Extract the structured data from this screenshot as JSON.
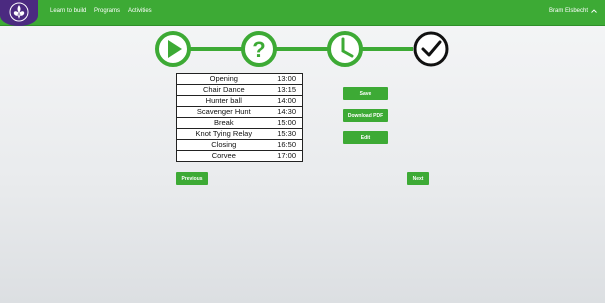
{
  "navbar": {
    "links": [
      "Learn to build",
      "Programs",
      "Activities"
    ],
    "user_name": "Bram Elsbecht"
  },
  "stepper": {
    "steps": [
      "play-step-icon",
      "question-step-icon",
      "clock-step-icon",
      "check-step-icon"
    ],
    "active_color": "#3daa35",
    "current_step_color": "#111111"
  },
  "schedule": [
    {
      "activity": "Opening",
      "time": "13:00"
    },
    {
      "activity": "Chair Dance",
      "time": "13:15"
    },
    {
      "activity": "Hunter ball",
      "time": "14:00"
    },
    {
      "activity": "Scavenger Hunt",
      "time": "14:30"
    },
    {
      "activity": "Break",
      "time": "15:00"
    },
    {
      "activity": "Knot Tying Relay",
      "time": "15:30"
    },
    {
      "activity": "Closing",
      "time": "16:50"
    },
    {
      "activity": "Corvee",
      "time": "17:00"
    }
  ],
  "actions": {
    "save": "Save",
    "download_pdf": "Download PDF",
    "edit": "Edit"
  },
  "pager": {
    "previous": "Previous",
    "next": "Next"
  },
  "colors": {
    "brand_green": "#3daa35",
    "logo_purple": "#4b2a80"
  }
}
